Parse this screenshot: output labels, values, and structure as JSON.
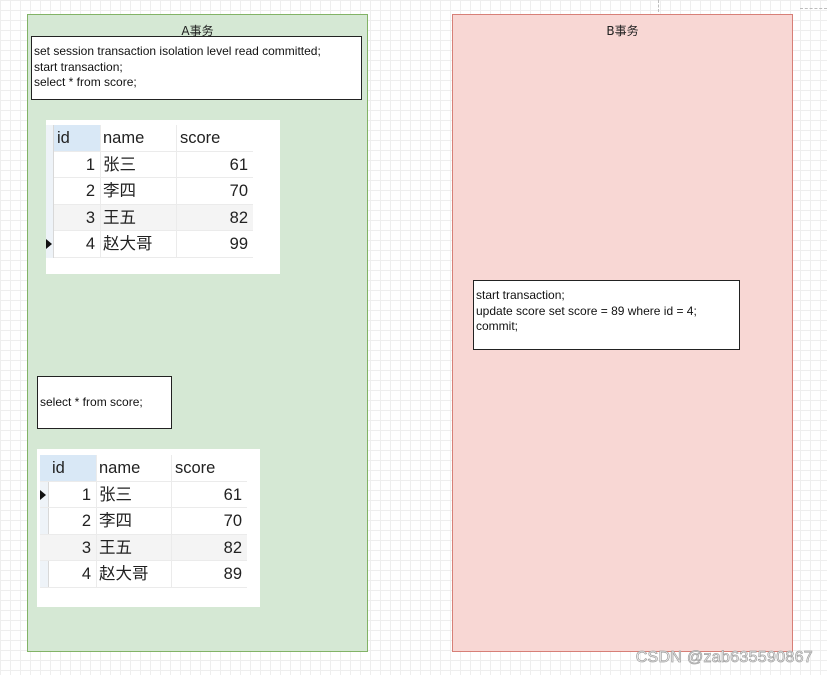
{
  "panels": {
    "a": {
      "title": "A事务",
      "color_fill": "#d5e8d4",
      "color_border": "#82b366",
      "query_1": [
        "set session transaction isolation level read committed;",
        "start transaction;",
        "select * from score;"
      ],
      "result_1": {
        "columns": [
          "id",
          "name",
          "score"
        ],
        "rows": [
          {
            "id": "1",
            "name": "张三",
            "score": "61"
          },
          {
            "id": "2",
            "name": "李四",
            "score": "70"
          },
          {
            "id": "3",
            "name": "王五",
            "score": "82"
          },
          {
            "id": "4",
            "name": "赵大哥",
            "score": "99"
          }
        ]
      },
      "query_2": "select * from score;",
      "result_2": {
        "columns": [
          "id",
          "name",
          "score"
        ],
        "rows": [
          {
            "id": "1",
            "name": "张三",
            "score": "61"
          },
          {
            "id": "2",
            "name": "李四",
            "score": "70"
          },
          {
            "id": "3",
            "name": "王五",
            "score": "82"
          },
          {
            "id": "4",
            "name": "赵大哥",
            "score": "89"
          }
        ]
      }
    },
    "b": {
      "title": "B事务",
      "color_fill": "#f8d7d4",
      "color_border": "#d77f77",
      "query": [
        "start transaction;",
        "update score set score = 89 where id = 4;",
        "commit;"
      ]
    }
  },
  "watermark": "CSDN @zab635590867"
}
